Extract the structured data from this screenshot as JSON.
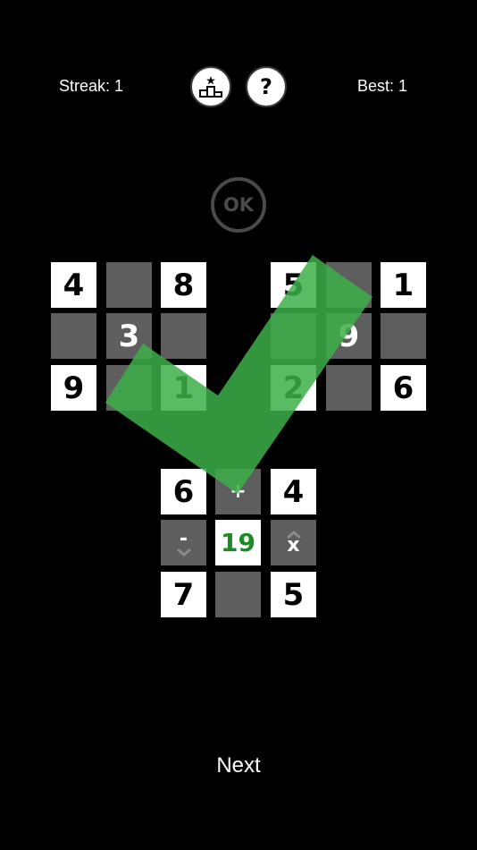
{
  "header": {
    "streak_label": "Streak: 1",
    "best_label": "Best: 1",
    "leaderboard_icon": "podium-star-icon",
    "help_label": "?"
  },
  "ok_button": {
    "label": "OK"
  },
  "top_grids": {
    "left": [
      "4",
      "",
      "8",
      "",
      "3",
      "",
      "9",
      "",
      "1"
    ],
    "right": [
      "5",
      "",
      "1",
      "",
      "9",
      "",
      "2",
      "",
      "6"
    ]
  },
  "equation_grid": {
    "top_left": "6",
    "top_op": "+",
    "top_right": "4",
    "left_op": "-",
    "target": "19",
    "right_op": "x",
    "bottom_left": "7",
    "bottom_op": "",
    "bottom_right": "5"
  },
  "feedback": {
    "type": "check-mark-icon",
    "color": "#3cb04a"
  },
  "footer": {
    "next_label": "Next"
  },
  "colors": {
    "target_text": "#1e8a24",
    "empty_cell": "#5e5e5e"
  }
}
